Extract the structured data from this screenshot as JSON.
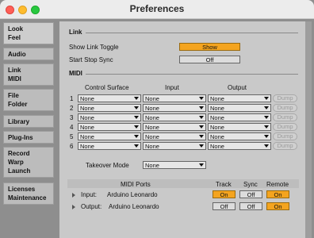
{
  "window": {
    "title": "Preferences"
  },
  "sidebar": {
    "items": [
      {
        "lines": [
          "Look",
          "Feel"
        ],
        "active": true
      },
      {
        "lines": [
          "Audio"
        ]
      },
      {
        "lines": [
          "Link",
          "MIDI"
        ]
      },
      {
        "lines": [
          "File",
          "Folder"
        ]
      },
      {
        "lines": [
          "Library"
        ]
      },
      {
        "lines": [
          "Plug-Ins"
        ]
      },
      {
        "lines": [
          "Record",
          "Warp",
          "Launch"
        ]
      },
      {
        "lines": [
          "Licenses",
          "Maintenance"
        ]
      }
    ]
  },
  "link": {
    "title": "Link",
    "show_link_toggle": {
      "label": "Show Link Toggle",
      "value": "Show"
    },
    "start_stop_sync": {
      "label": "Start Stop Sync",
      "value": "Off"
    }
  },
  "midi": {
    "title": "MIDI",
    "columns": {
      "control_surface": "Control Surface",
      "input": "Input",
      "output": "Output"
    },
    "rows": [
      {
        "num": "1",
        "cs": "None",
        "input": "None",
        "output": "None",
        "dump": "Dump"
      },
      {
        "num": "2",
        "cs": "None",
        "input": "None",
        "output": "None",
        "dump": "Dump"
      },
      {
        "num": "3",
        "cs": "None",
        "input": "None",
        "output": "None",
        "dump": "Dump"
      },
      {
        "num": "4",
        "cs": "None",
        "input": "None",
        "output": "None",
        "dump": "Dump"
      },
      {
        "num": "5",
        "cs": "None",
        "input": "None",
        "output": "None",
        "dump": "Dump"
      },
      {
        "num": "6",
        "cs": "None",
        "input": "None",
        "output": "None",
        "dump": "Dump"
      }
    ],
    "takeover_mode": {
      "label": "Takeover Mode",
      "value": "None"
    }
  },
  "ports": {
    "header": {
      "title": "MIDI Ports",
      "track": "Track",
      "sync": "Sync",
      "remote": "Remote"
    },
    "rows": [
      {
        "label": "Input:",
        "device": "Arduino Leonardo",
        "track": "On",
        "sync": "Off",
        "remote": "On",
        "track_on": true,
        "sync_on": false,
        "remote_on": true
      },
      {
        "label": "Output:",
        "device": "Arduino Leonardo",
        "track": "Off",
        "sync": "Off",
        "remote": "On",
        "track_on": false,
        "sync_on": false,
        "remote_on": true
      }
    ]
  },
  "colors": {
    "accent_on": "#f4a41f",
    "panel": "#c9c9c9",
    "sidebar": "#8e8e8e"
  }
}
